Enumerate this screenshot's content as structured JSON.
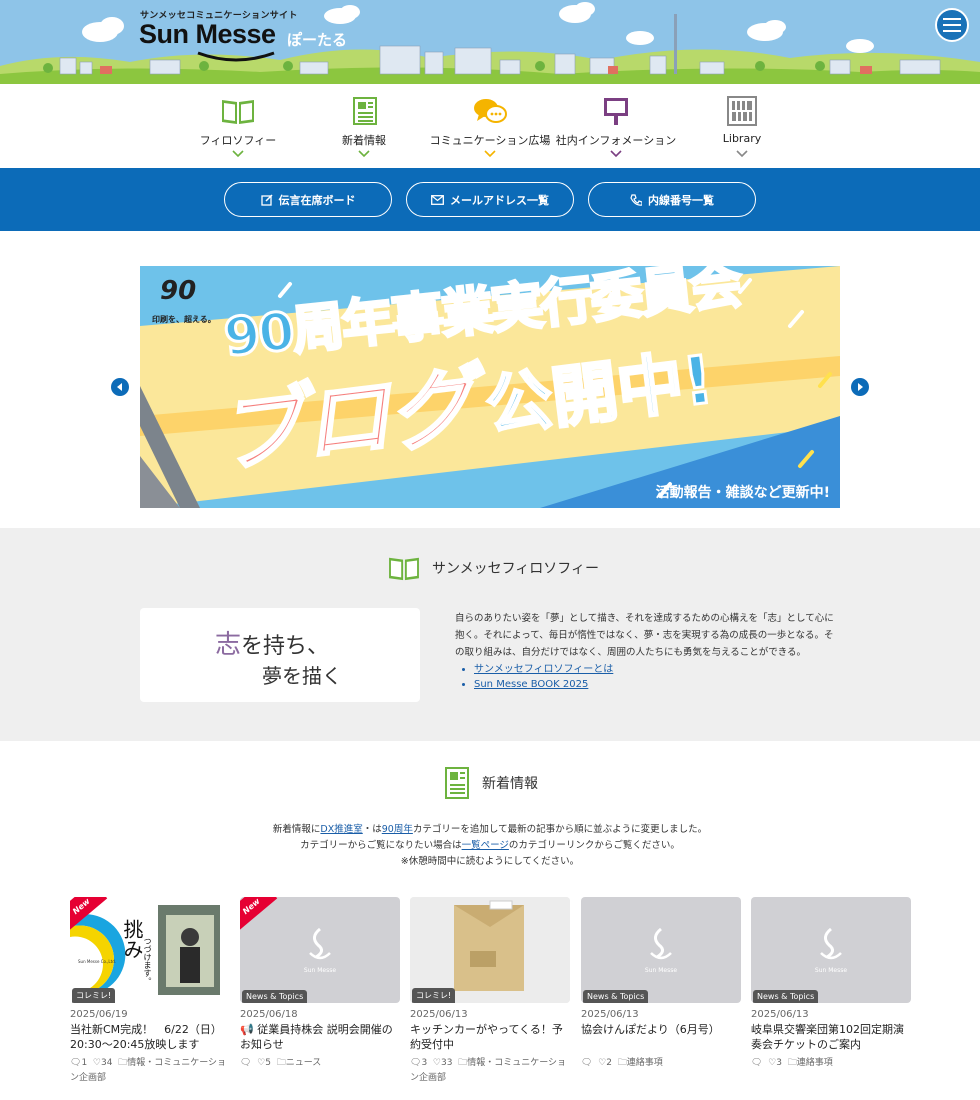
{
  "header": {
    "site_subtitle": "サンメッセコミュニケーションサイト",
    "logo_text": "Sun Messe",
    "portal_text": "ぽーたる"
  },
  "nav": [
    {
      "label": "フィロソフィー",
      "icon": "book-icon",
      "color": "#6db33f"
    },
    {
      "label": "新着情報",
      "icon": "newspaper-icon",
      "color": "#6db33f"
    },
    {
      "label": "コミュニケーション広場",
      "icon": "chat-bubbles-icon",
      "color": "#f5b400"
    },
    {
      "label": "社内インフォメーション",
      "icon": "signboard-icon",
      "color": "#7b3f82"
    },
    {
      "label": "Library",
      "icon": "library-icon",
      "color": "#888888"
    }
  ],
  "quick_links": [
    {
      "label": "伝言在席ボード",
      "icon": "edit-icon"
    },
    {
      "label": "メールアドレス一覧",
      "icon": "mail-icon"
    },
    {
      "label": "内線番号一覧",
      "icon": "phone-icon"
    }
  ],
  "banner": {
    "logo_number": "90",
    "logo_tagline": "印刷を、超える。",
    "line1": "90周年事業実行委員会",
    "line2": "ブログ",
    "line3": "公開中!",
    "footer": "活動報告・雑談など更新中!"
  },
  "philosophy": {
    "title": "サンメッセフィロソフィー",
    "calligraphy_line1_kanji": "志",
    "calligraphy_line1_rest": "を持ち、",
    "calligraphy_line2": "夢を描く",
    "text": "自らのありたい姿を「夢」として描き、それを達成するための心構えを「志」として心に抱く。それによって、毎日が惰性ではなく、夢・志を実現する為の成長の一歩となる。その取り組みは、自分だけではなく、周囲の人たちにも勇気を与えることができる。",
    "links": [
      "サンメッセフィロソフィーとは",
      "Sun Messe BOOK 2025"
    ]
  },
  "news": {
    "title": "新着情報",
    "intro_1a": "新着情報に",
    "intro_link1": "DX推進室",
    "intro_1b": "・は",
    "intro_link2": "90周年",
    "intro_1c": "カテゴリーを追加して最新の記事から順に並ぶように変更しました。",
    "intro_2a": "カテゴリーからご覧になりたい場合は",
    "intro_link3": "一覧ページ",
    "intro_2b": "のカテゴリーリンクからご覧ください。",
    "intro_3": "※休憩時間中に読むようにしてください。",
    "placeholder_logo": "Sun Messe",
    "cards": [
      {
        "new": "New",
        "tag": "コレミレ!",
        "date": "2025/06/19",
        "title": "当社新CM完成！　6/22（日）20:30～20:45放映します",
        "comments": "1",
        "likes": "34",
        "category": "情報・コミュニケーション企画部",
        "thumb_text1": "挑み",
        "thumb_text2": "つづけます。",
        "thumb_text3": "Sun Messe Co.,Ltd."
      },
      {
        "new": "New",
        "tag": "News & Topics",
        "date": "2025/06/18",
        "title": "📢 従業員持株会 説明会開催のお知らせ",
        "comments": "",
        "likes": "5",
        "category": "ニュース"
      },
      {
        "tag": "コレミレ!",
        "date": "2025/06/13",
        "title": "キッチンカーがやってくる！予約受付中",
        "comments": "3",
        "likes": "33",
        "category": "情報・コミュニケーション企画部"
      },
      {
        "tag": "News & Topics",
        "date": "2025/06/13",
        "title": "協会けんぽだより（6月号）",
        "comments": "",
        "likes": "2",
        "category": "連絡事項"
      },
      {
        "tag": "News & Topics",
        "date": "2025/06/13",
        "title": "岐阜県交響楽団第102回定期演奏会チケットのご案内",
        "comments": "",
        "likes": "3",
        "category": "連絡事項"
      }
    ]
  }
}
